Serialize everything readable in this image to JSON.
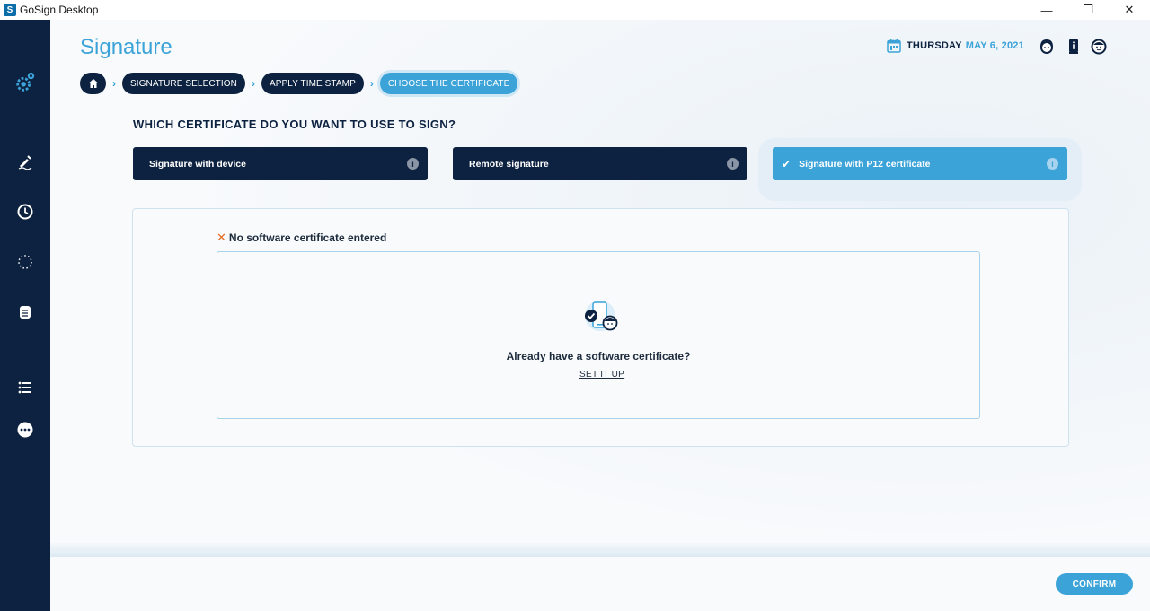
{
  "window": {
    "app_icon": "gosign-app-icon",
    "title": "GoSign Desktop",
    "controls": {
      "minimize": "—",
      "restore": "❐",
      "close": "✕"
    }
  },
  "sidebar": {
    "items": [
      {
        "name": "settings-gear-icon"
      },
      {
        "name": "signature-pen-icon"
      },
      {
        "name": "history-clock-icon"
      },
      {
        "name": "loading-spinner-icon"
      },
      {
        "name": "document-stack-icon"
      },
      {
        "name": "list-icon"
      },
      {
        "name": "more-options-icon"
      }
    ]
  },
  "header": {
    "title": "Signature",
    "day": "THURSDAY",
    "date": "MAY 6, 2021",
    "icons": [
      "support-agent-icon",
      "info-book-icon",
      "user-avatar-icon"
    ]
  },
  "breadcrumb": {
    "home_icon": "home-icon",
    "items": [
      {
        "label": "SIGNATURE SELECTION",
        "active": false
      },
      {
        "label": "APPLY TIME STAMP",
        "active": false
      },
      {
        "label": "CHOOSE THE CERTIFICATE",
        "active": true
      }
    ]
  },
  "question": "WHICH CERTIFICATE DO YOU WANT TO USE TO SIGN?",
  "options": [
    {
      "label": "Signature with device",
      "selected": false,
      "info": "i"
    },
    {
      "label": "Remote signature",
      "selected": false,
      "info": "i"
    },
    {
      "label": "Signature with P12 certificate",
      "selected": true,
      "info": "i",
      "check": "✔"
    }
  ],
  "panel": {
    "warning_mark": "✕",
    "warning": "No software certificate entered",
    "prompt": "Already have a software certificate?",
    "action": "SET IT UP"
  },
  "footer": {
    "confirm": "CONFIRM"
  },
  "colors": {
    "navy": "#0d2240",
    "accent": "#3ba3d8",
    "warning": "#e46a1f"
  }
}
